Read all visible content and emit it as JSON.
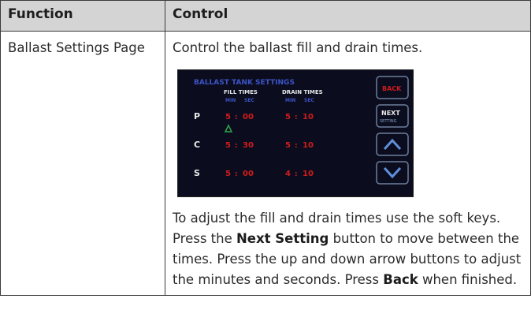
{
  "table": {
    "headers": [
      "Function",
      "Control"
    ],
    "rows": [
      {
        "function": "Ballast Settings Page",
        "description": "Control the ballast fill and drain times.",
        "instructions": {
          "part1": "To adjust the fill and drain times use the soft keys. Press the ",
          "bold1": "Next Setting",
          "part2": " button to move between the times. Press the up and down arrow buttons to adjust the minutes and seconds.  Press ",
          "bold2": "Back",
          "part3": " when finished."
        }
      }
    ]
  },
  "screen": {
    "title": "BALLAST TANK SETTINGS",
    "fill_header": "FILL TIMES",
    "drain_header": "DRAIN TIMES",
    "col_min": "MIN",
    "col_sec": "SEC",
    "rows": [
      {
        "label": "P",
        "fill_min": "5",
        "fill_sec": "00",
        "drain_min": "5",
        "drain_sec": "10"
      },
      {
        "label": "C",
        "fill_min": "5",
        "fill_sec": "30",
        "drain_min": "5",
        "drain_sec": "10"
      },
      {
        "label": "S",
        "fill_min": "5",
        "fill_sec": "00",
        "drain_min": "4",
        "drain_sec": "10"
      }
    ],
    "buttons": {
      "back": "BACK",
      "next": "NEXT",
      "next_sub": "SETTING"
    },
    "icons": {
      "selection_cursor": "triangle-up-outline",
      "up": "chevron-up-icon",
      "down": "chevron-down-icon"
    },
    "colors": {
      "background": "#0b0d1f",
      "title": "#3d54c8",
      "value": "#d11b1b",
      "label": "#e9e9e9",
      "cursor": "#2fa84a",
      "button_border": "#6d7f9b"
    }
  }
}
